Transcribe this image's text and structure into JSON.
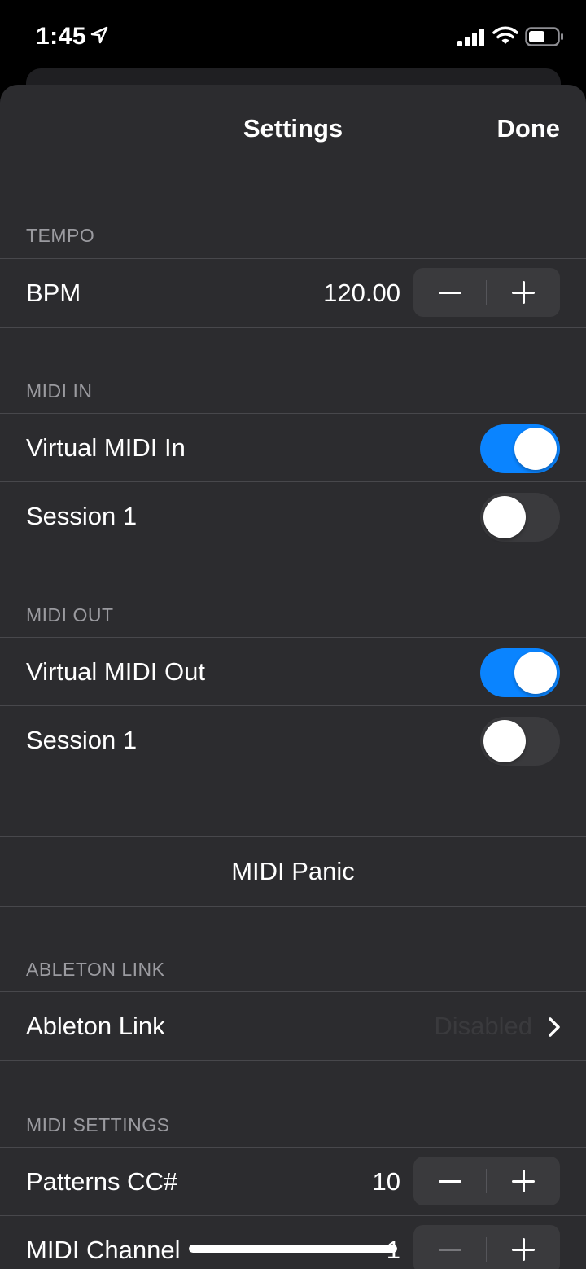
{
  "status_bar": {
    "time": "1:45"
  },
  "nav": {
    "title": "Settings",
    "done_label": "Done"
  },
  "sections": {
    "tempo": {
      "header": "TEMPO",
      "bpm_label": "BPM",
      "bpm_value": "120.00"
    },
    "midi_in": {
      "header": "MIDI IN",
      "rows": [
        {
          "label": "Virtual MIDI In",
          "on": true
        },
        {
          "label": "Session 1",
          "on": false
        }
      ]
    },
    "midi_out": {
      "header": "MIDI OUT",
      "rows": [
        {
          "label": "Virtual MIDI Out",
          "on": true
        },
        {
          "label": "Session 1",
          "on": false
        }
      ]
    },
    "panic": {
      "label": "MIDI Panic"
    },
    "ableton": {
      "header": "ABLETON LINK",
      "row_label": "Ableton Link",
      "row_value": "Disabled"
    },
    "midi_settings": {
      "header": "MIDI SETTINGS",
      "patterns_label": "Patterns CC#",
      "patterns_value": "10",
      "channel_label": "MIDI Channel",
      "channel_value": "1"
    }
  },
  "colors": {
    "accent": "#0a84ff",
    "background": "#2c2c2f",
    "separator": "#48484c"
  }
}
